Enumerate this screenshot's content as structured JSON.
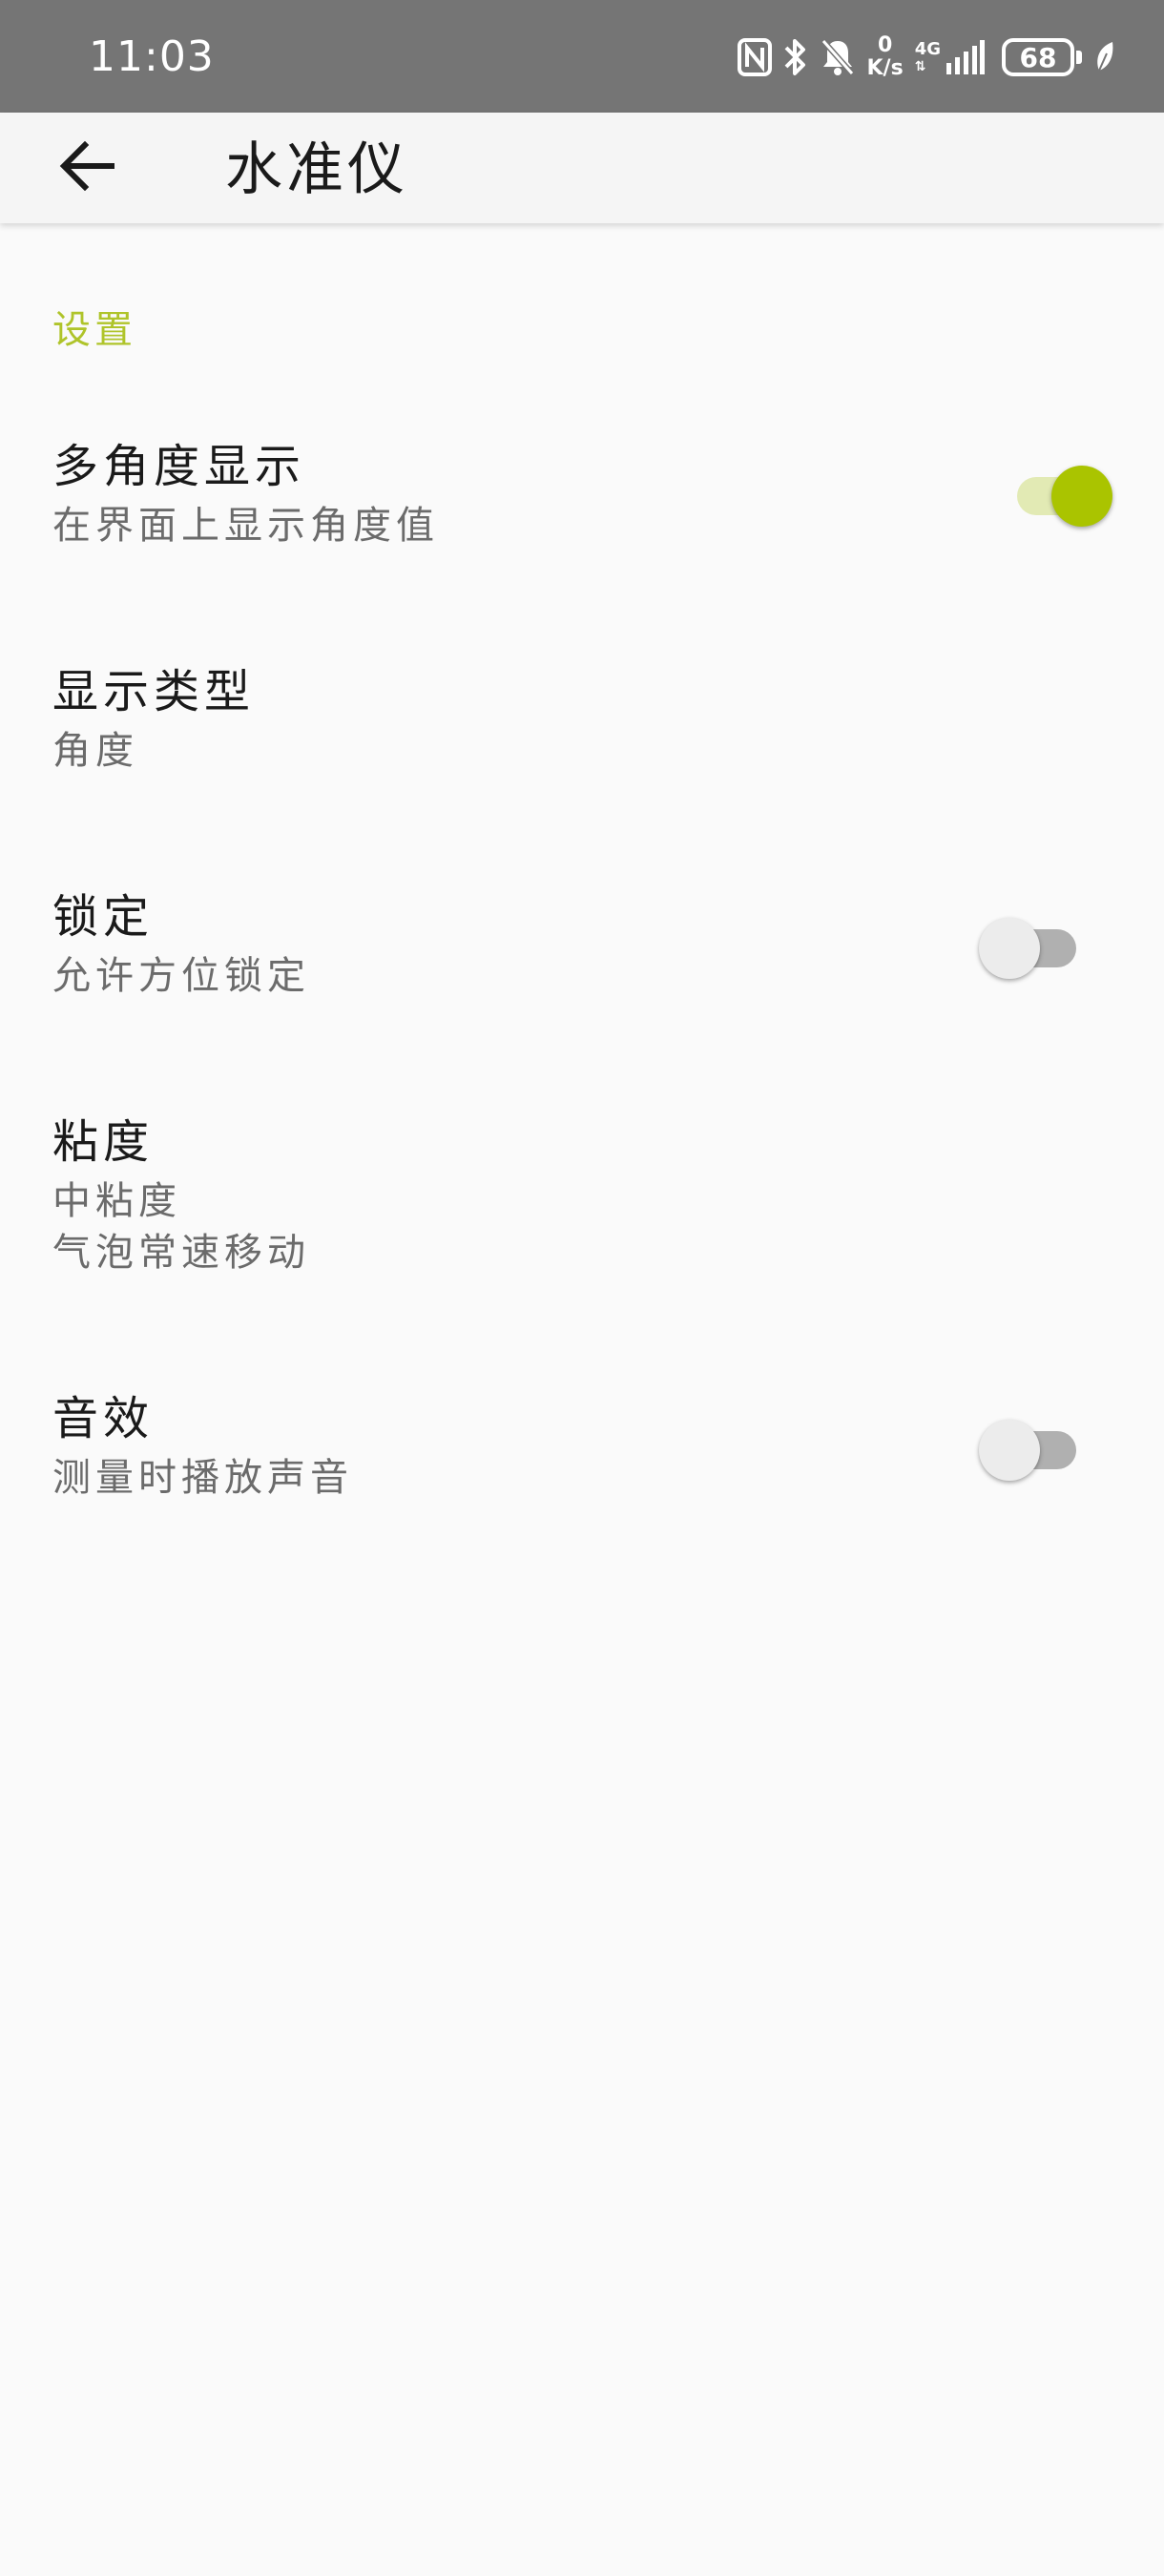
{
  "status_bar": {
    "time": "11:03",
    "net_speed_value": "0",
    "net_speed_unit": "K/s",
    "network_type": "4G",
    "battery_level": "68"
  },
  "toolbar": {
    "title": "水准仪"
  },
  "settings": {
    "section_header": "设置",
    "items": [
      {
        "title": "多角度显示",
        "summary": "在界面上显示角度值",
        "switch_on": true
      },
      {
        "title": "显示类型",
        "summary": "角度"
      },
      {
        "title": "锁定",
        "summary": "允许方位锁定",
        "switch_on": false
      },
      {
        "title": "粘度",
        "summary": "中粘度",
        "summary2": "气泡常速移动"
      },
      {
        "title": "音效",
        "summary": "测量时播放声音",
        "switch_on": false
      }
    ]
  },
  "colors": {
    "accent": "#aac400",
    "status_bar": "#757575",
    "background": "#fafafa"
  }
}
